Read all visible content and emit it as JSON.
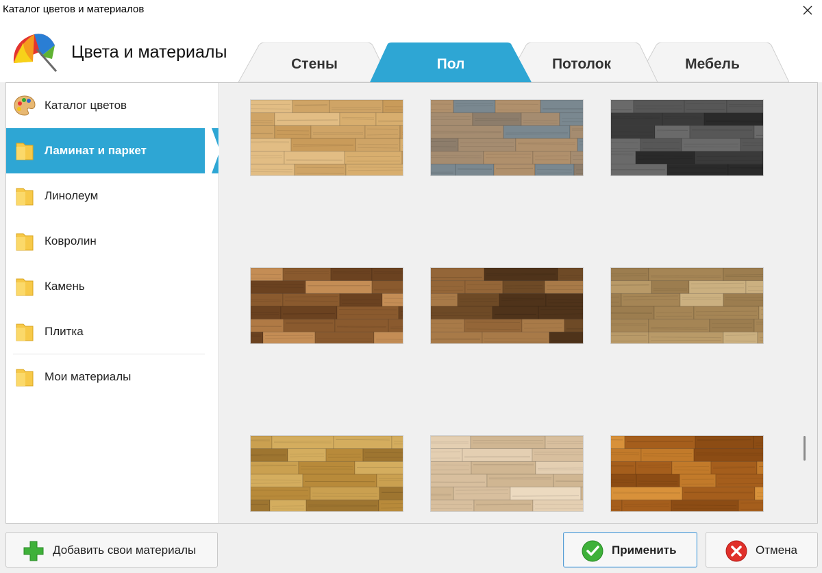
{
  "window": {
    "title": "Каталог цветов и материалов"
  },
  "header": {
    "title": "Цвета и материалы"
  },
  "tabs": [
    {
      "label": "Стены",
      "active": false
    },
    {
      "label": "Пол",
      "active": true
    },
    {
      "label": "Потолок",
      "active": false
    },
    {
      "label": "Мебель",
      "active": false
    }
  ],
  "sidebar": {
    "items": [
      {
        "label": "Каталог цветов",
        "icon": "palette-icon",
        "active": false
      },
      {
        "label": "Ламинат и паркет",
        "icon": "folder-icon",
        "active": true
      },
      {
        "label": "Линолеум",
        "icon": "folder-icon",
        "active": false
      },
      {
        "label": "Ковролин",
        "icon": "folder-icon",
        "active": false
      },
      {
        "label": "Камень",
        "icon": "folder-icon",
        "active": false
      },
      {
        "label": "Плитка",
        "icon": "folder-icon",
        "active": false
      },
      {
        "label": "Мои материалы",
        "icon": "folder-icon",
        "active": false
      }
    ]
  },
  "textures": [
    {
      "name": "light-pine-laminate",
      "colors": [
        "#d8ae6e",
        "#c99b5a",
        "#e2bd84",
        "#cfa466"
      ]
    },
    {
      "name": "weathered-grey-wood",
      "colors": [
        "#8d7d6b",
        "#a58c70",
        "#7a8890",
        "#b0906c"
      ]
    },
    {
      "name": "dark-grey-wood",
      "colors": [
        "#3a3a3a",
        "#575757",
        "#2a2a2a",
        "#6a6a6a"
      ]
    },
    {
      "name": "reclaimed-brown-wood",
      "colors": [
        "#8a5a2e",
        "#b07a45",
        "#6b4220",
        "#c48d55"
      ]
    },
    {
      "name": "knotty-walnut-wood",
      "colors": [
        "#6e4a26",
        "#946638",
        "#4f331a",
        "#a87a48"
      ]
    },
    {
      "name": "light-oak-parquet",
      "colors": [
        "#b99a68",
        "#a58555",
        "#cbb080",
        "#9c7d4f"
      ]
    },
    {
      "name": "golden-rustic-wood",
      "colors": [
        "#b88a3a",
        "#caa050",
        "#9e7530",
        "#d4ad5e"
      ]
    },
    {
      "name": "pale-beige-parquet",
      "colors": [
        "#e4cfb2",
        "#d8bf9e",
        "#ecdac0",
        "#d0b692"
      ]
    },
    {
      "name": "amber-knotty-pine",
      "colors": [
        "#c27a2a",
        "#a55e1c",
        "#d8913a",
        "#8c4c14"
      ]
    }
  ],
  "buttons": {
    "add_label": "Добавить свои материалы",
    "apply_label": "Применить",
    "cancel_label": "Отмена"
  },
  "colors": {
    "accent": "#2ea6d4",
    "tab_inactive": "#f4f4f4"
  }
}
